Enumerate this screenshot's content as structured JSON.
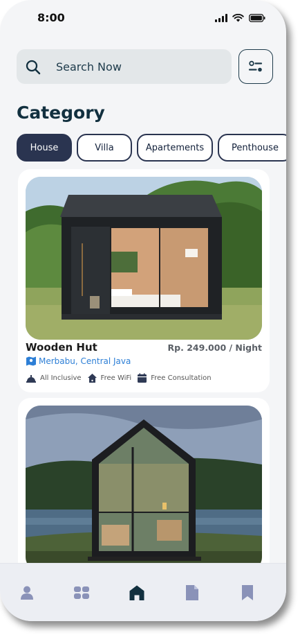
{
  "status": {
    "time": "8:00"
  },
  "search": {
    "placeholder": "Search Now"
  },
  "category": {
    "title": "Category",
    "chips": [
      "House",
      "Villa",
      "Apartements",
      "Penthouse"
    ]
  },
  "listings": [
    {
      "name": "Wooden Hut",
      "price": "Rp. 249.000 / Night",
      "location": "Merbabu, Central Java",
      "amenities": [
        "All Inclusive",
        "Free WiFi",
        "Free Consultation"
      ]
    }
  ],
  "colors": {
    "primary": "#2a3450",
    "location_blue": "#2d7fd6",
    "nav_active": "#12303f",
    "nav_inactive": "#8a92b8"
  },
  "nav": [
    "profile-icon",
    "grid-icon",
    "home-icon",
    "document-icon",
    "bookmark-icon"
  ]
}
